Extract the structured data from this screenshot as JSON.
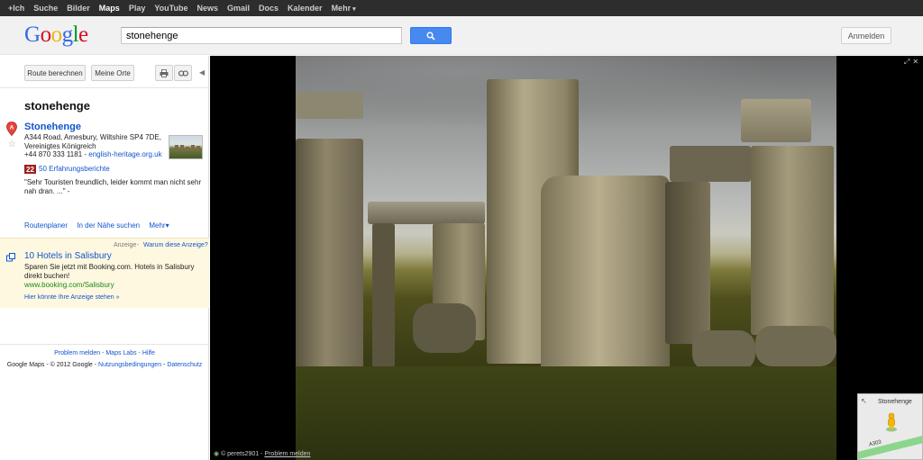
{
  "gbar": {
    "items": [
      "+Ich",
      "Suche",
      "Bilder",
      "Maps",
      "Play",
      "YouTube",
      "News",
      "Gmail",
      "Docs",
      "Kalender",
      "Mehr"
    ],
    "active": "Maps"
  },
  "header": {
    "logo": "Google",
    "search_value": "stonehenge",
    "signin_label": "Anmelden"
  },
  "toolbar": {
    "route_label": "Route berechnen",
    "myplaces_label": "Meine Orte"
  },
  "query_title": "stonehenge",
  "result": {
    "marker": "A",
    "name": "Stonehenge",
    "address": "A344 Road, Amesbury, Wiltshire SP4 7DE, Vereinigtes Königreich",
    "phone": "+44 870 333 1181",
    "website": "english-heritage.org.uk",
    "review_count_badge": "22",
    "reviews_link": "50 Erfahrungsberichte",
    "snippet": "\"Sehr Touristen freundlich, leider kommt man nicht sehr nah dran. ...\" -"
  },
  "actions": {
    "route": "Routenplaner",
    "nearby": "In der Nähe suchen",
    "more": "Mehr"
  },
  "ad": {
    "label": "Anzeige",
    "why": "Warum diese Anzeige?",
    "title": "10 Hotels in Salisbury",
    "text": "Sparen Sie jetzt mit Booking.com. Hotels in Salisbury direkt buchen!",
    "url": "www.booking.com/Salisbury",
    "more": "Hier könnte Ihre Anzeige stehen »"
  },
  "footer": {
    "report": "Problem melden",
    "labs": "Maps Labs",
    "help": "Hilfe",
    "copyright": "Google Maps - © 2012 Google",
    "terms": "Nutzungsbedingungen",
    "privacy": "Datenschutz"
  },
  "photo": {
    "credit": "© perets2901 -",
    "report": "Problem melden"
  },
  "minimap": {
    "label": "Stonehenge",
    "road": "A303"
  },
  "colors": {
    "link": "#1155cc",
    "search_button": "#4889f0",
    "gbar": "#2d2d2d",
    "badge": "#9e1f1f"
  }
}
